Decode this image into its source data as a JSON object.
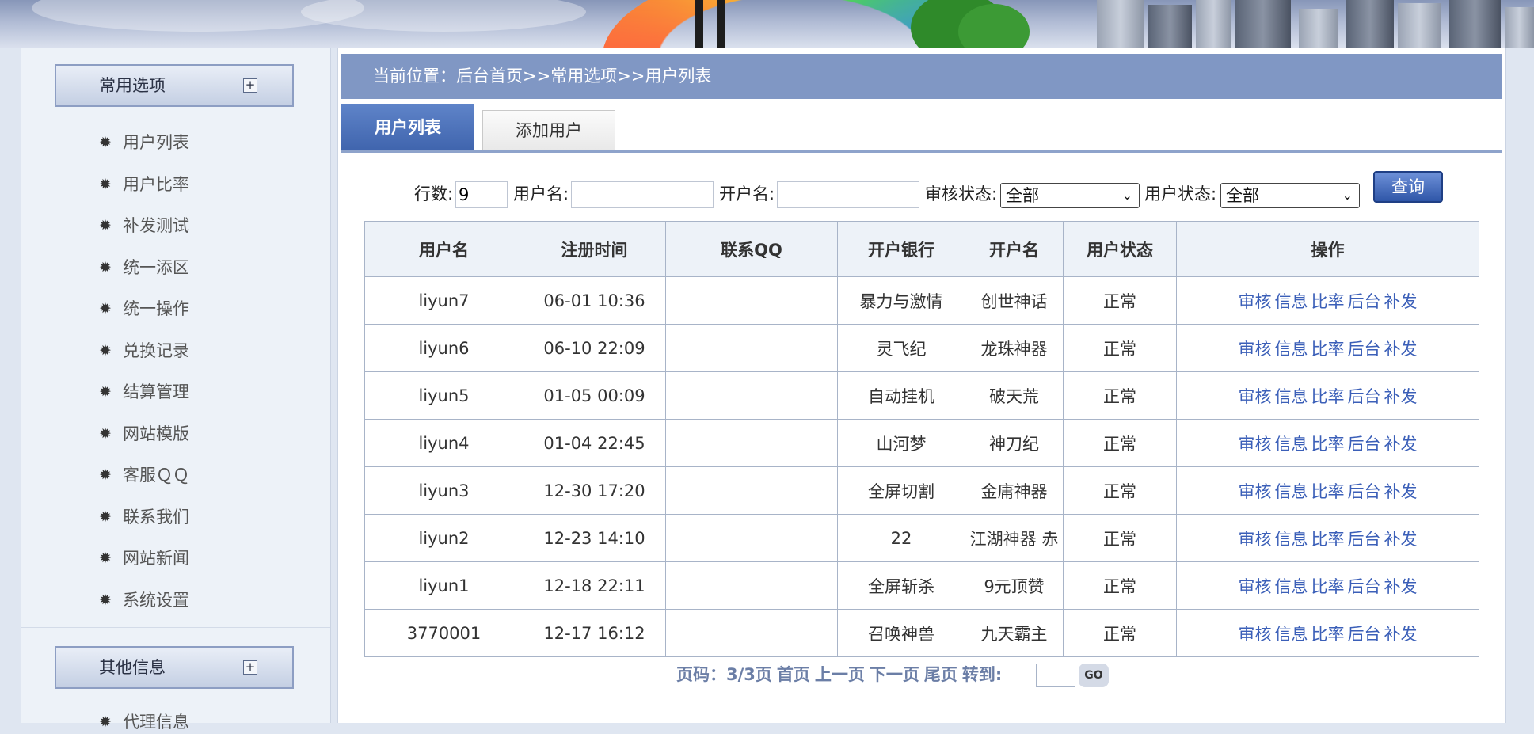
{
  "sidebar": {
    "group1_title": "常用选项",
    "group2_title": "其他信息",
    "items": [
      "用户列表",
      "用户比率",
      "补发测试",
      "统一添区",
      "统一操作",
      "兑换记录",
      "结算管理",
      "网站模版",
      "客服ＱＱ",
      "联系我们",
      "网站新闻",
      "系统设置"
    ],
    "group2_items": [
      "代理信息"
    ]
  },
  "breadcrumb": "当前位置：后台首页>>常用选项>>用户列表",
  "tabs": {
    "active": "用户列表",
    "other": "添加用户"
  },
  "filters": {
    "rows_label": "行数:",
    "rows_value": "9",
    "username_label": "用户名:",
    "username_value": "",
    "account_name_label": "开户名:",
    "account_name_value": "",
    "review_label": "审核状态:",
    "review_value": "全部",
    "user_status_label": "用户状态:",
    "user_status_value": "全部",
    "query_button": "查询"
  },
  "table": {
    "headers": [
      "用户名",
      "注册时间",
      "联系QQ",
      "开户银行",
      "开户名",
      "用户状态",
      "操作"
    ],
    "actions": [
      "审核",
      "信息",
      "比率",
      "后台",
      "补发"
    ],
    "rows": [
      {
        "user": "liyun7",
        "time": "06-01 10:36",
        "qq": "",
        "bank": "暴力与激情",
        "name": "创世神话",
        "status": "正常"
      },
      {
        "user": "liyun6",
        "time": "06-10 22:09",
        "qq": "",
        "bank": "灵飞纪",
        "name": "龙珠神器",
        "status": "正常"
      },
      {
        "user": "liyun5",
        "time": "01-05 00:09",
        "qq": "",
        "bank": "自动挂机",
        "name": "破天荒",
        "status": "正常"
      },
      {
        "user": "liyun4",
        "time": "01-04 22:45",
        "qq": "",
        "bank": "山河梦",
        "name": "神刀纪",
        "status": "正常"
      },
      {
        "user": "liyun3",
        "time": "12-30 17:20",
        "qq": "",
        "bank": "全屏切割",
        "name": "金庸神器",
        "status": "正常"
      },
      {
        "user": "liyun2",
        "time": "12-23 14:10",
        "qq": "",
        "bank": "22",
        "name": "江湖神器 赤",
        "status": "正常"
      },
      {
        "user": "liyun1",
        "time": "12-18 22:11",
        "qq": "",
        "bank": "全屏斩杀",
        "name": "9元顶赞",
        "status": "正常"
      },
      {
        "user": "3770001",
        "time": "12-17 16:12",
        "qq": "",
        "bank": "召唤神兽",
        "name": "九天霸主",
        "status": "正常"
      }
    ]
  },
  "pager": {
    "page_info": "页码：3/3页",
    "first": "首页",
    "prev": "上一页",
    "next": "下一页",
    "last": "尾页",
    "goto_label": "转到:",
    "goto_value": "",
    "go": "GO"
  },
  "icons": {
    "menu_bullet": "gear-icon",
    "expand": "plus-box-icon"
  }
}
